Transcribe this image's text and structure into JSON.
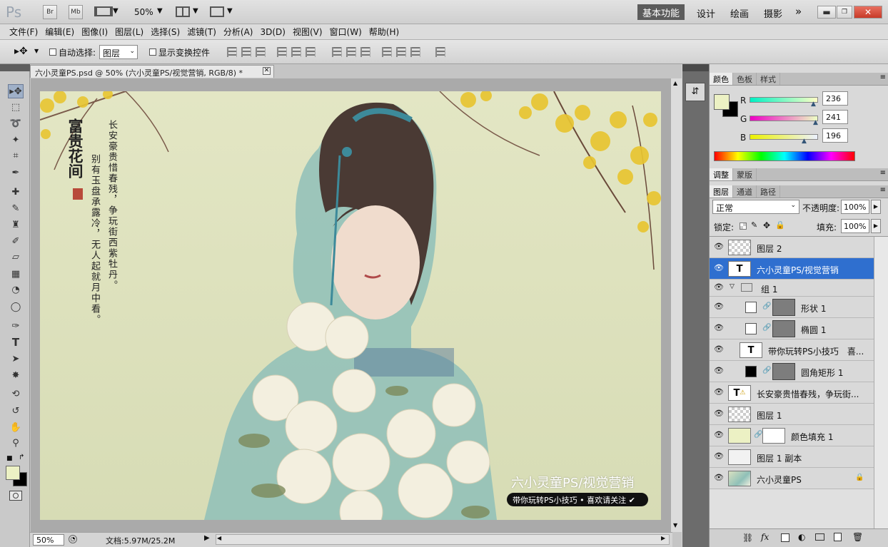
{
  "app": {
    "logo": "Ps",
    "bridge": "Br",
    "minibridge": "Mb",
    "zoom": "50%"
  },
  "workspaces": {
    "essentials": "基本功能",
    "design": "设计",
    "painting": "绘画",
    "photography": "摄影"
  },
  "menu": [
    "文件(F)",
    "编辑(E)",
    "图像(I)",
    "图层(L)",
    "选择(S)",
    "滤镜(T)",
    "分析(A)",
    "3D(D)",
    "视图(V)",
    "窗口(W)",
    "帮助(H)"
  ],
  "options": {
    "auto_select_label": "自动选择:",
    "auto_select_value": "图层",
    "show_transform_label": "显示变换控件"
  },
  "document": {
    "tab_title": "六小灵童PS.psd @ 50% (六小灵童PS/视觉营销, RGB/8) *",
    "zoom": "50%",
    "doc_size": "文档:5.97M/25.2M"
  },
  "artwork": {
    "calligraphy_col1": "富贵花间",
    "calligraphy_col2": "长安豪贵惜春残，争玩街西紫牡丹。",
    "calligraphy_col3": "别有玉盘承露冷，无人起就月中看。",
    "watermark_title": "六小灵童PS/视觉营销",
    "watermark_sub": "带你玩转PS小技巧 • 喜欢请关注 ✔"
  },
  "color_panel": {
    "tabs": [
      "颜色",
      "色板",
      "样式"
    ],
    "r_label": "R",
    "g_label": "G",
    "b_label": "B",
    "r": "236",
    "g": "241",
    "b": "196",
    "fg_color": "#ecf1c4",
    "bg_color": "#000000"
  },
  "adjust_panel": {
    "tabs": [
      "调整",
      "蒙版"
    ]
  },
  "layers_panel": {
    "tabs": [
      "图层",
      "通道",
      "路径"
    ],
    "blend_mode": "正常",
    "opacity_label": "不透明度:",
    "opacity": "100%",
    "lock_label": "锁定:",
    "fill_label": "填充:",
    "fill": "100%",
    "layers": [
      {
        "name": "图层 2"
      },
      {
        "name": "六小灵童PS/视觉营销",
        "selected": true
      },
      {
        "name": "组 1"
      },
      {
        "name": "形状 1"
      },
      {
        "name": "椭圆 1"
      },
      {
        "name": "带你玩转PS小技巧　喜..."
      },
      {
        "name": "圆角矩形 1"
      },
      {
        "name": "长安豪贵惜春残，争玩街..."
      },
      {
        "name": "图层 1"
      },
      {
        "name": "颜色填充 1"
      },
      {
        "name": "图层 1 副本"
      },
      {
        "name": "六小灵童PS"
      }
    ]
  },
  "icons": [
    "move-tool-icon",
    "marquee-icon",
    "lasso-icon",
    "quick-select-icon",
    "crop-icon",
    "eyedropper-icon",
    "brush-icon",
    "stamp-icon",
    "eraser-icon",
    "gradient-icon",
    "pen-icon",
    "type-icon",
    "hand-icon",
    "zoom-icon",
    "eye-icon",
    "lock-icon",
    "link-icon",
    "fx-icon",
    "trash-icon"
  ]
}
